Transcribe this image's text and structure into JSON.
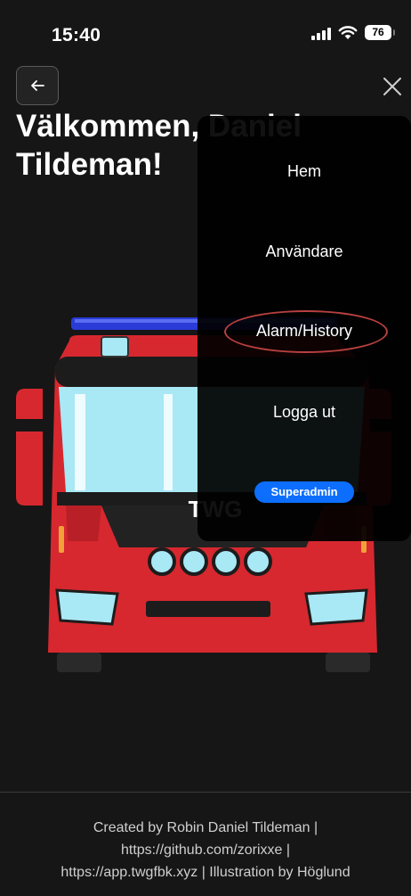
{
  "status_bar": {
    "time": "15:40",
    "battery": "76",
    "icons": [
      "signal-icon",
      "wifi-icon",
      "battery-icon"
    ]
  },
  "header": {
    "back_icon": "arrow-left-icon",
    "close_icon": "close-icon"
  },
  "page": {
    "title_line1": "Välkommen, Daniel",
    "title_line2": "Tildeman!"
  },
  "illustration": {
    "truck_text": "TWG",
    "colors": {
      "body": "#d7282f",
      "lightbar": "#2a3bd8",
      "glass": "#a9e8f5"
    }
  },
  "menu": {
    "items": [
      {
        "label": "Hem"
      },
      {
        "label": "Användare"
      },
      {
        "label": "Alarm/History"
      },
      {
        "label": "Logga ut"
      }
    ],
    "role_badge": "Superadmin",
    "highlight_color": "#b8403f",
    "badge_color": "#0d6efd"
  },
  "footer": {
    "line1": "Created by Robin Daniel Tildeman |",
    "line2": "https://github.com/zorixxe |",
    "line3": "https://app.twgfbk.xyz | Illustration by Höglund"
  }
}
